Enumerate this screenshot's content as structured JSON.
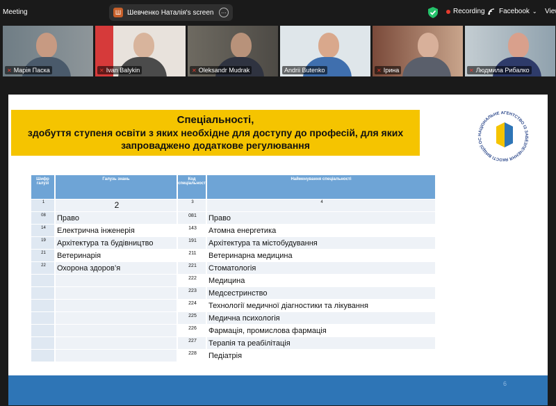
{
  "topbar": {
    "meeting_label": "Meeting",
    "share_label": "Шевченко Наталія's screen",
    "share_avatar": "Ш",
    "more_icon": "⋯",
    "recording_label": "Recording",
    "facebook_label": "Facebook",
    "view_label": "View"
  },
  "participants": [
    {
      "name": "Марія Паска",
      "muted": true
    },
    {
      "name": "Ivan Balykin",
      "muted": true
    },
    {
      "name": "Oleksandr Mudrak",
      "muted": true
    },
    {
      "name": "Andrii Butenko",
      "muted": false,
      "active": true
    },
    {
      "name": "Ірина",
      "muted": true
    },
    {
      "name": "Людмила Рибалко",
      "muted": true
    }
  ],
  "slide": {
    "title_line1": "Спеціальності,",
    "title_line2": "здобуття ступеня освіти з яких необхідне для доступу до професій, для яких",
    "title_line3": "запроваджено додаткове регулювання",
    "logo_text": "НАЦІОНАЛЬНЕ АГЕНТСТВО ІЗ ЗАБЕЗПЕЧЕННЯ ЯКОСТІ ВИЩОЇ ОСВІТИ",
    "header": {
      "col1": "Шифр галузі",
      "col2": "Галузь знань",
      "col3": "Код спеціальності",
      "col4": "Найменування спеціальності"
    },
    "numbers": [
      "1",
      "2",
      "3",
      "4"
    ],
    "rows": [
      {
        "code1": "08",
        "field": "Право",
        "code2": "081",
        "spec": "Право"
      },
      {
        "code1": "14",
        "field": "Електрична інженерія",
        "code2": "143",
        "spec": "Атомна енергетика"
      },
      {
        "code1": "19",
        "field": "Архітектура та будівництво",
        "code2": "191",
        "spec": "Архітектура та містобудування"
      },
      {
        "code1": "21",
        "field": "Ветеринарія",
        "code2": "211",
        "spec": "Ветеринарна медицина"
      },
      {
        "code1": "22",
        "field": "Охорона здоров’я",
        "code2": "221",
        "spec": "Стоматологія"
      },
      {
        "code1": "",
        "field": "",
        "code2": "222",
        "spec": "Медицина"
      },
      {
        "code1": "",
        "field": "",
        "code2": "223",
        "spec": "Медсестринство"
      },
      {
        "code1": "",
        "field": "",
        "code2": "224",
        "spec": "Технології медичної діагностики та лікування"
      },
      {
        "code1": "",
        "field": "",
        "code2": "225",
        "spec": "Медична психологія"
      },
      {
        "code1": "",
        "field": "",
        "code2": "226",
        "spec": "Фармація, промислова фармація"
      },
      {
        "code1": "",
        "field": "",
        "code2": "227",
        "spec": "Терапія та реабілітація"
      },
      {
        "code1": "",
        "field": "",
        "code2": "228",
        "spec": "Педіатрія"
      }
    ],
    "page_number": "6"
  },
  "colors": {
    "title_bg": "#f5c400",
    "header_blue": "#6ea4d6",
    "bottom_bar": "#2e75b6",
    "active_speaker": "#25c26b",
    "record_red": "#e63b2e"
  }
}
